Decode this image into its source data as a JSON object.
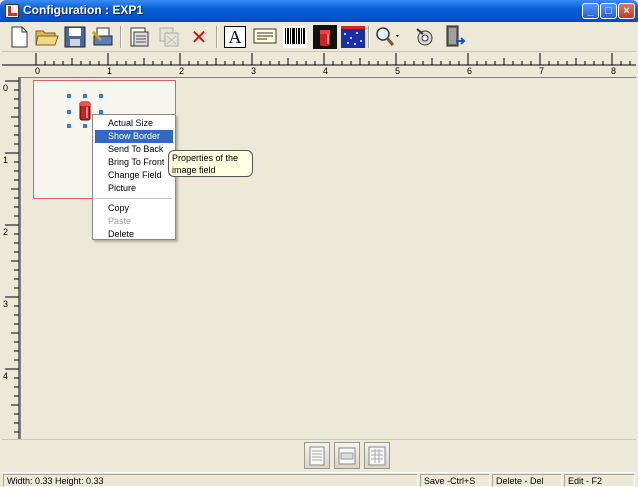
{
  "window": {
    "title": "Configuration : EXP1",
    "minimize_glyph": "_",
    "maximize_glyph": "□",
    "close_glyph": "×"
  },
  "toolbar": {
    "icons": [
      "new-file-icon",
      "open-folder-icon",
      "save-disk-icon",
      "print-icon",
      "page-setup-icon",
      "copy-fields-icon",
      "delete-x-icon",
      "text-field-icon",
      "text-frame-icon",
      "barcode-icon",
      "image-field-icon",
      "graphic-field-icon",
      "zoom-icon",
      "settings-icon",
      "exit-door-icon"
    ],
    "text_field_glyph": "A",
    "delete_glyph": "✕"
  },
  "ruler": {
    "top_labels": [
      "0",
      "1",
      "2",
      "3",
      "4",
      "5",
      "6",
      "7",
      "8"
    ],
    "left_labels": [
      "0",
      "1",
      "2",
      "3",
      "4"
    ]
  },
  "context_menu": {
    "items": [
      {
        "label": "Actual Size",
        "state": "normal"
      },
      {
        "label": "Show Border",
        "state": "highlighted"
      },
      {
        "label": "Send To Back",
        "state": "normal"
      },
      {
        "label": "Bring To Front",
        "state": "normal"
      },
      {
        "label": "Change Field",
        "state": "normal"
      },
      {
        "label": "Picture",
        "state": "normal"
      }
    ],
    "items2": [
      {
        "label": "Copy",
        "state": "normal"
      },
      {
        "label": "Paste",
        "state": "disabled"
      },
      {
        "label": "Delete",
        "state": "normal"
      }
    ]
  },
  "tooltip": {
    "text": "Properties of the image field"
  },
  "bottom_buttons": [
    "page-view-icon",
    "label-view-icon",
    "grid-view-icon"
  ],
  "status": {
    "dimensions": "Width: 0.33 Height: 0.33",
    "save": "Save -Ctrl+S",
    "delete": "Delete - Del",
    "edit": "Edit - F2"
  },
  "colors": {
    "title_bar": "#0052cc",
    "menu_highlight": "#316ac5",
    "label_border": "#e06060",
    "selection_handle": "#3a78e0",
    "tooltip_bg": "#ffffe1"
  }
}
